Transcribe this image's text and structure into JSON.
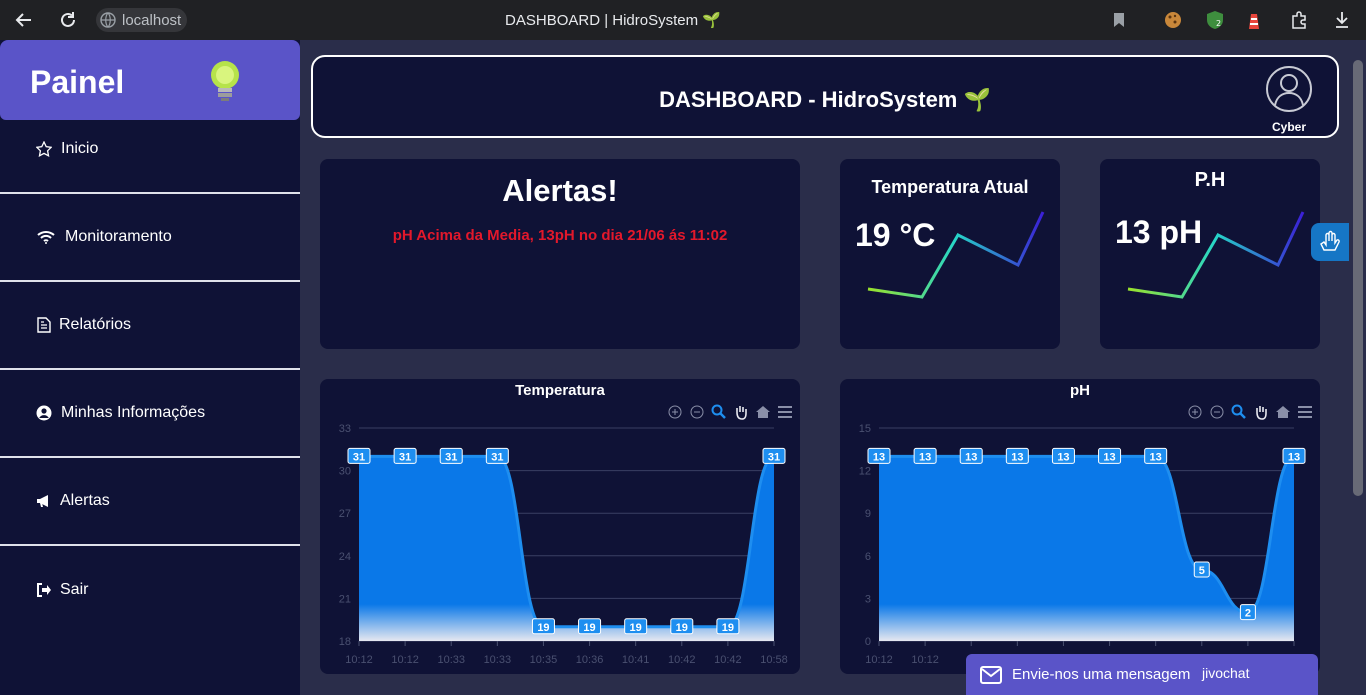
{
  "browser": {
    "url": "localhost",
    "tab_title": "DASHBOARD | HidroSystem 🌱"
  },
  "sidebar": {
    "title": "Painel",
    "items": [
      {
        "label": "Inicio",
        "icon": "star-icon"
      },
      {
        "label": "Monitoramento",
        "icon": "wifi-icon"
      },
      {
        "label": "Relatórios",
        "icon": "document-icon"
      },
      {
        "label": "Minhas Informações",
        "icon": "user-circle-icon"
      },
      {
        "label": "Alertas",
        "icon": "megaphone-icon"
      },
      {
        "label": "Sair",
        "icon": "logout-icon"
      }
    ]
  },
  "header": {
    "title": "DASHBOARD - HidroSystem 🌱",
    "user_name": "Cyber"
  },
  "alerts": {
    "title": "Alertas!",
    "message": "pH Acima da Media, 13pH no dia 21/06 ás 11:02"
  },
  "temperature_card": {
    "title": "Temperatura Atual",
    "value": "19 °C"
  },
  "ph_card": {
    "title": "P.H",
    "value": "13 pH"
  },
  "chat": {
    "label": "Envie-nos uma mensagem",
    "brand": "jivochat"
  },
  "colors": {
    "accent": "#5a54c8",
    "panel": "#0f1236",
    "background": "#2a2d4a",
    "alert": "#e3182b",
    "series": "#1e8ef0"
  },
  "chart_data": [
    {
      "type": "area",
      "title": "Temperatura",
      "x": [
        "10:12",
        "10:12",
        "10:33",
        "10:33",
        "10:35",
        "10:36",
        "10:41",
        "10:42",
        "10:42",
        "10:58"
      ],
      "y_ticks": [
        18,
        21,
        24,
        27,
        30,
        33
      ],
      "ylim": [
        18,
        33
      ],
      "series": [
        {
          "values": [
            31,
            31,
            31,
            31,
            19,
            19,
            19,
            19,
            19,
            31
          ]
        }
      ],
      "grid": true
    },
    {
      "type": "area",
      "title": "pH",
      "x": [
        "10:12",
        "10:12"
      ],
      "y_ticks": [
        0,
        3,
        6,
        9,
        12,
        15
      ],
      "ylim": [
        0,
        15
      ],
      "series": [
        {
          "values": [
            13,
            13,
            13,
            13,
            13,
            13,
            13,
            5,
            2,
            13
          ]
        }
      ],
      "grid": true
    }
  ]
}
